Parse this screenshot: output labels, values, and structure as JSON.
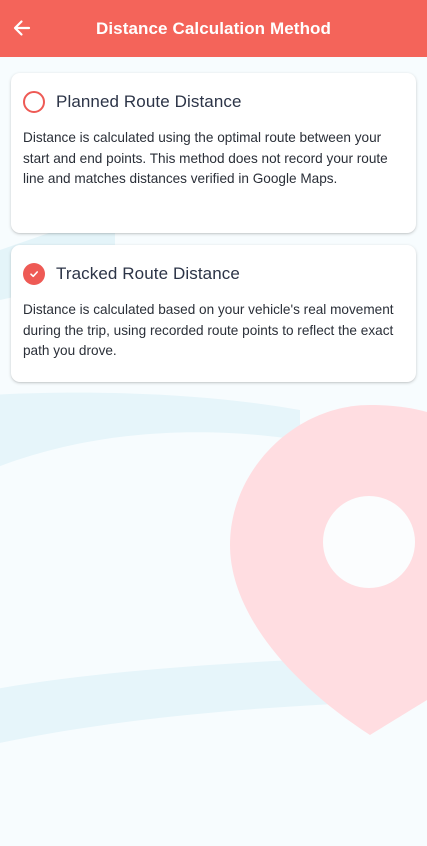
{
  "header": {
    "title": "Distance Calculation Method",
    "back_icon": "arrow-left-icon"
  },
  "options": [
    {
      "title": "Planned Route Distance",
      "description": "Distance is calculated using the optimal route between your start and end points. This method does not record your route line and matches distances verified in Google Maps.",
      "selected": false
    },
    {
      "title": "Tracked Route Distance",
      "description": "Distance is calculated based on your vehicle's real movement during the trip, using recorded route points to reflect the exact path you drove.",
      "selected": true
    }
  ],
  "colors": {
    "accent": "#f4645a",
    "radio": "#ee5a55",
    "pin": "#ffdce0",
    "road": "#e3f4f9",
    "background": "#f7fcfe"
  }
}
